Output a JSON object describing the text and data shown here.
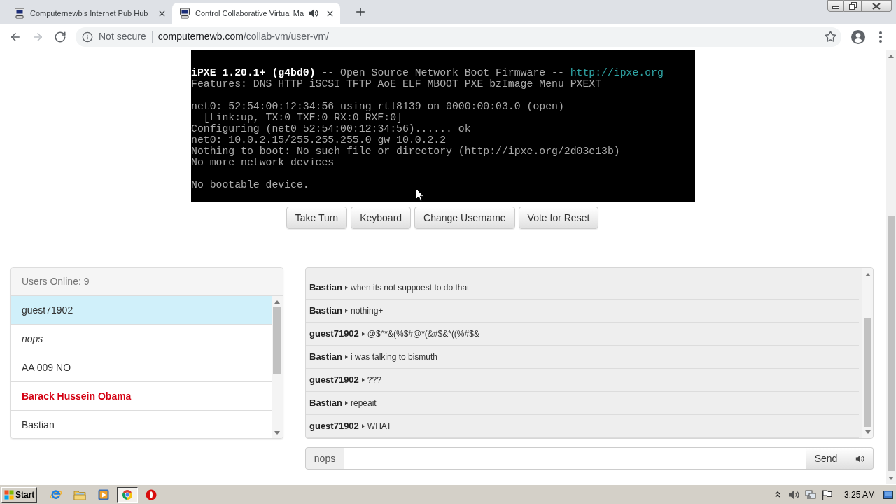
{
  "browser": {
    "tabs": [
      {
        "title": "Computernewb's Internet Pub Hub",
        "selected": false,
        "audio": false
      },
      {
        "title": "Control Collaborative Virtual Ma",
        "selected": true,
        "audio": true
      }
    ],
    "nav": [
      {
        "kind": "back",
        "disabled": false
      },
      {
        "kind": "forward",
        "disabled": true
      },
      {
        "kind": "reload",
        "disabled": false
      }
    ],
    "address": {
      "security": "Not secure",
      "host": "computernewb.com",
      "path": "/collab-vm/user-vm/"
    }
  },
  "vm_screen": {
    "blocks": [
      {
        "lines": [
          {
            "spans": [
              {
                "text": "iPXE 1.20.1+ (g4bd0)",
                "kind": "bright"
              },
              {
                "text": " -- Open Source Network Boot Firmware -- ",
                "kind": "normal"
              },
              {
                "text": "http://ipxe.org",
                "kind": "link"
              }
            ]
          },
          {
            "spans": [
              {
                "text": "Features: DNS HTTP iSCSI TFTP AoE ELF MBOOT PXE bzImage Menu PXEXT",
                "kind": "normal"
              }
            ]
          }
        ]
      },
      {
        "lines": [
          {
            "spans": [
              {
                "text": "net0: 52:54:00:12:34:56 using rtl8139 on 0000:00:03.0 (open)",
                "kind": "normal"
              }
            ]
          },
          {
            "spans": [
              {
                "text": "  [Link:up, TX:0 TXE:0 RX:0 RXE:0]",
                "kind": "normal"
              }
            ]
          },
          {
            "spans": [
              {
                "text": "Configuring (net0 52:54:00:12:34:56)...... ok",
                "kind": "normal"
              }
            ]
          },
          {
            "spans": [
              {
                "text": "net0: 10.0.2.15/255.255.255.0 gw 10.0.2.2",
                "kind": "normal"
              }
            ]
          },
          {
            "spans": [
              {
                "text": "Nothing to boot: No such file or directory (http://ipxe.org/2d03e13b)",
                "kind": "normal"
              }
            ]
          },
          {
            "spans": [
              {
                "text": "No more network devices",
                "kind": "normal"
              }
            ]
          }
        ]
      },
      {
        "lines": [
          {
            "spans": [
              {
                "text": "No bootable device.",
                "kind": "normal"
              }
            ]
          }
        ]
      }
    ]
  },
  "vm_buttons": [
    "Take Turn",
    "Keyboard",
    "Change Username",
    "Vote for Reset"
  ],
  "users": {
    "header": "Users Online: 9",
    "items": [
      {
        "name": "guest71902",
        "kind": "plain",
        "selected": true
      },
      {
        "name": "nops",
        "kind": "italic",
        "selected": false
      },
      {
        "name": "AA 009 NO",
        "kind": "plain",
        "selected": false
      },
      {
        "name": "Barack Hussein Obama",
        "kind": "admin",
        "selected": false
      },
      {
        "name": "Bastian",
        "kind": "plain",
        "selected": false
      }
    ]
  },
  "chat": {
    "messages": [
      {
        "user": "Bastian",
        "text": "when its not suppoest to do that"
      },
      {
        "user": "Bastian",
        "text": "nothing+"
      },
      {
        "user": "guest71902",
        "text": "@$^*&(%$#@*(&#$&*((%#$&"
      },
      {
        "user": "Bastian",
        "text": "i was talking to bismuth"
      },
      {
        "user": "guest71902",
        "text": "???"
      },
      {
        "user": "Bastian",
        "text": "repeait"
      },
      {
        "user": "guest71902",
        "text": "WHAT"
      }
    ],
    "input": {
      "username": "nops",
      "send": "Send"
    }
  },
  "taskbar": {
    "start": "Start",
    "apps": [
      {
        "kind": "ie",
        "selected": false
      },
      {
        "kind": "folder",
        "selected": false
      },
      {
        "kind": "player",
        "selected": false
      },
      {
        "kind": "chrome",
        "selected": true
      },
      {
        "kind": "opera",
        "selected": false
      }
    ],
    "clock": "3:25 AM"
  }
}
